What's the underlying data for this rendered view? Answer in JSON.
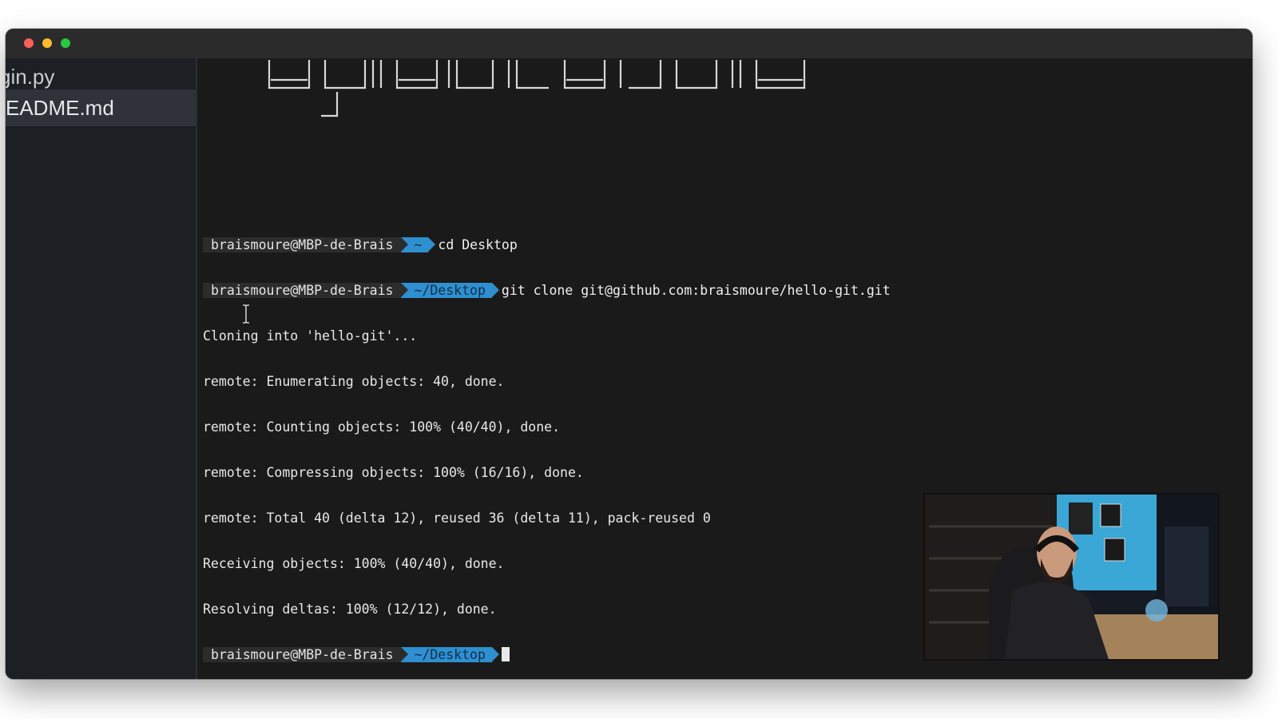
{
  "sidebar": {
    "files": [
      {
        "label": "gin.py"
      },
      {
        "label": "EADME.md"
      }
    ]
  },
  "terminal": {
    "prompt_user": "braismoure@MBP-de-Brais",
    "lines": [
      {
        "dir": "~",
        "command": "cd Desktop"
      },
      {
        "dir": "~/Desktop",
        "command": "git clone git@github.com:braismoure/hello-git.git"
      },
      {
        "text": "Cloning into 'hello-git'..."
      },
      {
        "text": "remote: Enumerating objects: 40, done."
      },
      {
        "text": "remote: Counting objects: 100% (40/40), done."
      },
      {
        "text": "remote: Compressing objects: 100% (16/16), done."
      },
      {
        "text": "remote: Total 40 (delta 12), reused 36 (delta 11), pack-reused 0"
      },
      {
        "text": "Receiving objects: 100% (40/40), done."
      },
      {
        "text": "Resolving deltas: 100% (12/12), done."
      },
      {
        "dir": "~/Desktop"
      }
    ]
  },
  "colors": {
    "prompt_segment": "#2f8fcf",
    "background": "#1a1a1a"
  },
  "icons": [
    "close-light",
    "minimize-light",
    "zoom-light",
    "text-cursor-icon"
  ]
}
